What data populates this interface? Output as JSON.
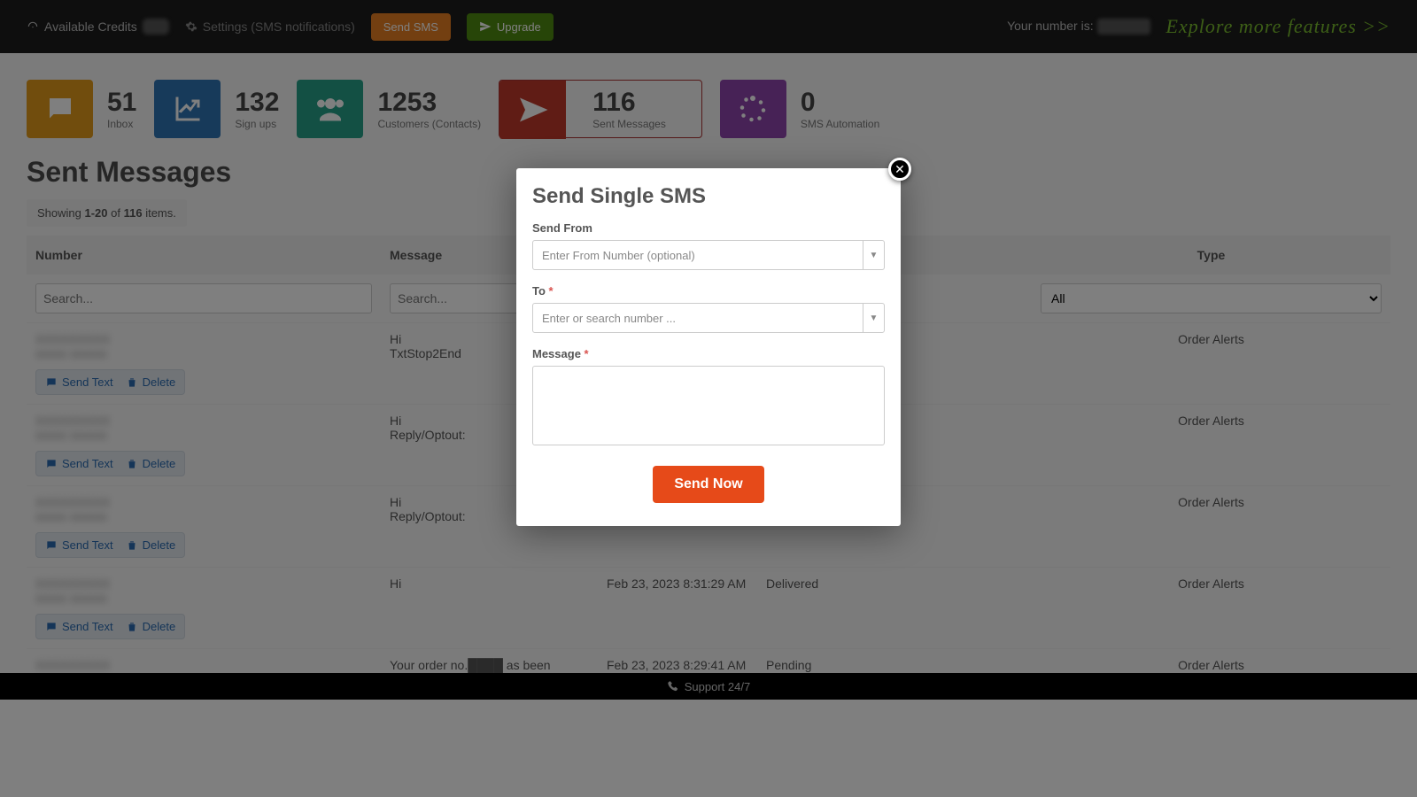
{
  "topbar": {
    "credits_label": "Available Credits",
    "settings_label": "Settings (SMS notifications)",
    "send_sms": "Send SMS",
    "upgrade": "Upgrade",
    "your_number_label": "Your number is:",
    "explore": "Explore more features >>"
  },
  "stats": {
    "inbox": {
      "value": "51",
      "label": "Inbox"
    },
    "signups": {
      "value": "132",
      "label": "Sign ups"
    },
    "customers": {
      "value": "1253",
      "label": "Customers (Contacts)"
    },
    "sent": {
      "value": "116",
      "label": "Sent Messages"
    },
    "automation": {
      "value": "0",
      "label": "SMS Automation"
    }
  },
  "page": {
    "title": "Sent Messages"
  },
  "grid": {
    "showing_prefix": "Showing ",
    "showing_range": "1-20",
    "showing_mid": " of ",
    "showing_total": "116",
    "showing_suffix": " items.",
    "cols": {
      "number": "Number",
      "message": "Message",
      "type": "Type"
    },
    "search_placeholder": "Search...",
    "type_filter": "All",
    "rows": [
      {
        "number": "XXXXXXXXX",
        "name": "xxxxx xxxxxx",
        "message": "Hi\nTxtStop2End",
        "date": "",
        "status": "",
        "type": "Order Alerts",
        "actions": true
      },
      {
        "number": "XXXXXXXXX",
        "name": "xxxxx xxxxxx",
        "message": "Hi\nReply/Optout:",
        "date": "",
        "status": "",
        "type": "Order Alerts",
        "actions": true
      },
      {
        "number": "XXXXXXXXX",
        "name": "xxxxx xxxxxx",
        "message": "Hi\nReply/Optout:",
        "date": "",
        "status": "",
        "type": "Order Alerts",
        "actions": true
      },
      {
        "number": "XXXXXXXXX",
        "name": "xxxxx xxxxxx",
        "message": "Hi",
        "date": "Feb 23, 2023 8:31:29 AM",
        "status": "Delivered",
        "type": "Order Alerts",
        "actions": true
      },
      {
        "number": "XXXXXXXXX",
        "name": "",
        "message": "Your order no.████ as been successfully",
        "date": "Feb 23, 2023 8:29:41 AM",
        "status": "Pending",
        "type": "Order Alerts",
        "actions": false
      }
    ],
    "action_send": "Send Text",
    "action_delete": "Delete"
  },
  "footer": {
    "support": "Support 24/7"
  },
  "modal": {
    "title": "Send Single SMS",
    "from_label": "Send From",
    "from_placeholder": "Enter From Number (optional)",
    "to_label": "To ",
    "to_placeholder": "Enter or search number ...",
    "message_label": "Message ",
    "send_now": "Send Now"
  }
}
